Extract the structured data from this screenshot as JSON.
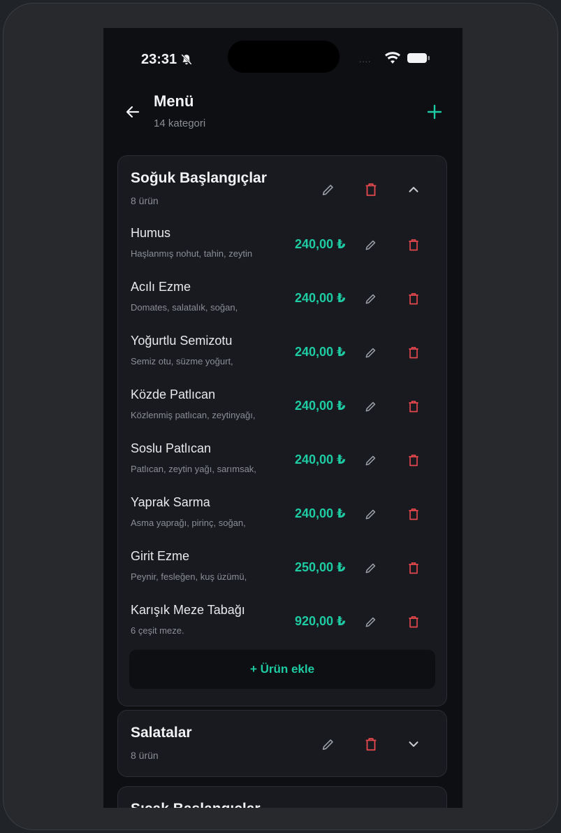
{
  "status_bar": {
    "time": "23:31",
    "signal_dots": "...."
  },
  "header": {
    "title": "Menü",
    "subtitle": "14 kategori"
  },
  "categories": [
    {
      "name": "Soğuk Başlangıçlar",
      "count": "8 ürün",
      "expanded": true,
      "items": [
        {
          "name": "Humus",
          "desc": "Haşlanmış nohut, tahin, zeytin",
          "price": "240,00 ₺"
        },
        {
          "name": "Acılı Ezme",
          "desc": "Domates, salatalık, soğan,",
          "price": "240,00 ₺"
        },
        {
          "name": "Yoğurtlu Semizotu",
          "desc": "Semiz otu, süzme yoğurt,",
          "price": "240,00 ₺"
        },
        {
          "name": "Közde Patlıcan",
          "desc": "Közlenmiş patlıcan, zeytinyağı,",
          "price": "240,00 ₺"
        },
        {
          "name": "Soslu Patlıcan",
          "desc": "Patlıcan, zeytin yağı, sarımsak,",
          "price": "240,00 ₺"
        },
        {
          "name": "Yaprak Sarma",
          "desc": "Asma yaprağı, pirinç, soğan,",
          "price": "240,00 ₺"
        },
        {
          "name": "Girit Ezme",
          "desc": "Peynir, fesleğen, kuş üzümü,",
          "price": "250,00 ₺"
        },
        {
          "name": "Karışık Meze Tabağı",
          "desc": "6 çeşit meze.",
          "price": "920,00 ₺"
        }
      ],
      "add_label": "+ Ürün ekle"
    },
    {
      "name": "Salatalar",
      "count": "8 ürün",
      "expanded": false
    },
    {
      "name": "Sıcak Başlangıçlar",
      "expanded": false
    }
  ],
  "colors": {
    "accent": "#1ecba3",
    "danger": "#e5484d",
    "background": "#0d0f12",
    "card": "#181a1f"
  },
  "icons": [
    "bell-slash-icon",
    "wifi-icon",
    "battery-icon",
    "back-arrow-icon",
    "plus-icon",
    "pencil-icon",
    "trash-icon",
    "chevron-up-icon",
    "chevron-down-icon"
  ]
}
